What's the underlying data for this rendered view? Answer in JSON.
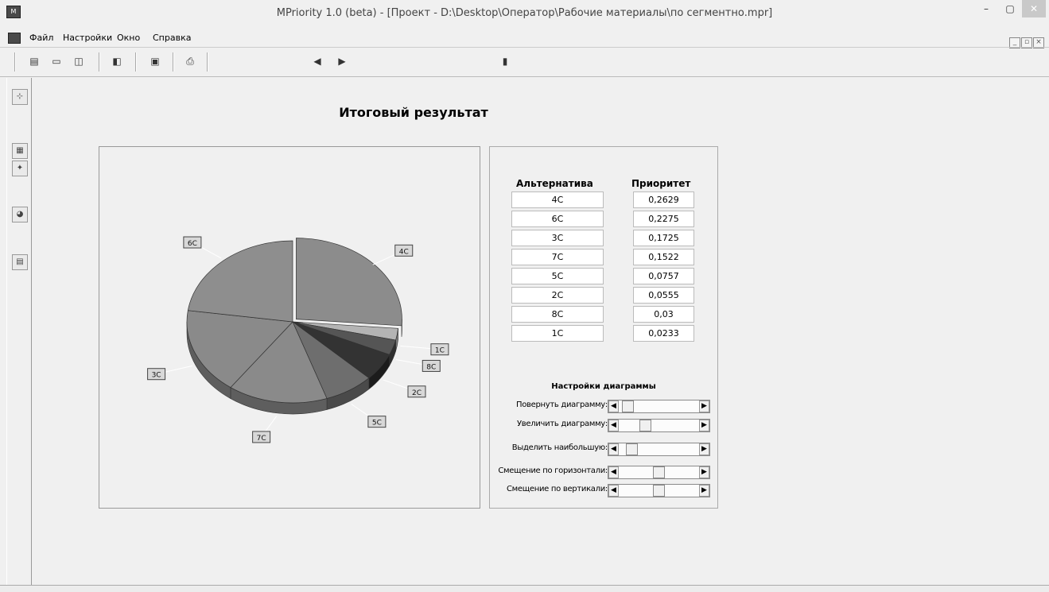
{
  "window": {
    "title": "MPriority 1.0 (beta) - [Проект - D:\\Desktop\\Оператор\\Рабочие материалы\\по сегментно.mpr]"
  },
  "menu": {
    "items": [
      "Файл",
      "Настройки",
      "Окно",
      "Справка"
    ]
  },
  "toolbar": {
    "icons": [
      "new-icon",
      "open-icon",
      "print-preview-icon",
      "save-icon",
      "properties-icon",
      "print-icon",
      "back-icon",
      "forward-icon",
      "exit-icon"
    ]
  },
  "main": {
    "title": "Итоговый результат"
  },
  "table": {
    "header_alt": "Альтернатива",
    "header_prio": "Приоритет",
    "rows": [
      {
        "alt": "4C",
        "prio": "0,2629"
      },
      {
        "alt": "6C",
        "prio": "0,2275"
      },
      {
        "alt": "3C",
        "prio": "0,1725"
      },
      {
        "alt": "7C",
        "prio": "0,1522"
      },
      {
        "alt": "5C",
        "prio": "0,0757"
      },
      {
        "alt": "2C",
        "prio": "0,0555"
      },
      {
        "alt": "8C",
        "prio": "0,03"
      },
      {
        "alt": "1C",
        "prio": "0,0233"
      }
    ]
  },
  "settings": {
    "title": "Настройки диаграммы",
    "rotate": {
      "label": "Повернуть диаграмму:",
      "level": 0.05
    },
    "zoom": {
      "label": "Увеличить диаграмму:",
      "level": 0.3
    },
    "highlight": {
      "label": "Выделить наибольшую:",
      "level": 0.1
    },
    "hshift": {
      "label": "Смещение по горизонтали:",
      "level": 0.5
    },
    "vshift": {
      "label": "Смещение по вертикали:",
      "level": 0.5
    }
  },
  "chart_data": {
    "type": "pie",
    "categories": [
      "4C",
      "1C",
      "8C",
      "2C",
      "5C",
      "7C",
      "3C",
      "6C"
    ],
    "values": [
      0.2629,
      0.0233,
      0.03,
      0.0555,
      0.0757,
      0.1522,
      0.1725,
      0.2275
    ],
    "exploded": "4C"
  }
}
